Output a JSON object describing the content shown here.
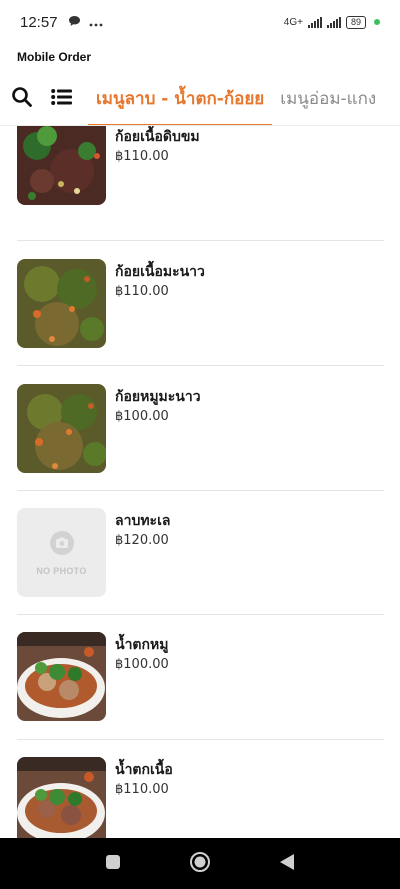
{
  "status_bar": {
    "time": "12:57",
    "network": "4G+",
    "battery": "89"
  },
  "app": {
    "title": "Mobile Order"
  },
  "header": {
    "tabs": [
      {
        "label": "เมนูลาบ - น้ำตก-ก้อยย",
        "active": true
      },
      {
        "label": "เมนูอ่อม-แกง",
        "active": false
      }
    ]
  },
  "menu_items": [
    {
      "name": "ก้อยเนื้อดิบขม",
      "price": "฿110.00",
      "photo": "larb-dark"
    },
    {
      "name": "ก้อยเนื้อมะนาว",
      "price": "฿110.00",
      "photo": "larb-green"
    },
    {
      "name": "ก้อยหมูมะนาว",
      "price": "฿100.00",
      "photo": "larb-green"
    },
    {
      "name": "ลาบทะเล",
      "price": "฿120.00",
      "photo": "none",
      "placeholder_label": "NO PHOTO"
    },
    {
      "name": "น้ำตกหมู",
      "price": "฿100.00",
      "photo": "namtok-plate"
    },
    {
      "name": "น้ำตกเนื้อ",
      "price": "฿110.00",
      "photo": "namtok-plate"
    }
  ],
  "colors": {
    "accent": "#e8772e",
    "inactive_tab": "#8a8a8a",
    "divider": "#e4e4e4",
    "nav_bar": "#000000"
  },
  "icons": [
    "message-icon",
    "more-icon",
    "signal-icon",
    "battery-icon",
    "search-icon",
    "list-menu-icon",
    "camera-icon",
    "nav-recent-icon",
    "nav-home-icon",
    "nav-back-icon"
  ]
}
